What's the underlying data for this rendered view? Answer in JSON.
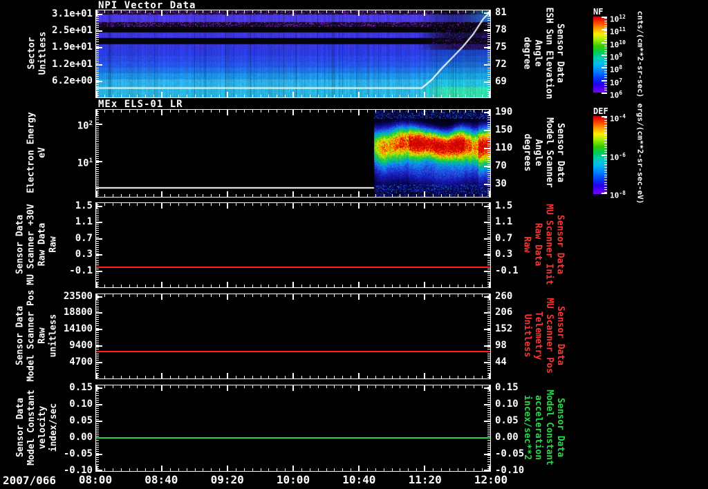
{
  "screen": {
    "background": "#000000",
    "axis_color": "#ffffff",
    "red_series_color": "#ff2222",
    "green_series_color": "#22dd44"
  },
  "x_axis": {
    "date_label": "2007/066",
    "tick_labels": [
      "08:00",
      "08:40",
      "09:20",
      "10:00",
      "10:40",
      "11:20",
      "12:00"
    ]
  },
  "panels": [
    {
      "title": "NPI Vector Data",
      "left_axis": {
        "label_lines": [
          "Sector",
          "Unitless"
        ],
        "tick_labels": [
          "3.1e+01",
          "2.5e+01",
          "1.9e+01",
          "1.2e+01",
          "6.2e+00"
        ]
      },
      "right_axis": {
        "label_lines": [
          "Sensor Data",
          "ESH Sun Elevation",
          "Angle",
          "degree"
        ],
        "tick_labels": [
          "81",
          "78",
          "75",
          "72",
          "69"
        ],
        "color": "#ffffff"
      },
      "colorbar": {
        "name": "NF",
        "units": "cnts/(cm**2-sr-sec)",
        "tick_exponents": [
          "12",
          "11",
          "10",
          "9",
          "8",
          "7",
          "6"
        ]
      }
    },
    {
      "title": "MEx ELS-01 LR",
      "left_axis": {
        "label_lines": [
          "Electron Energy",
          "eV"
        ],
        "tick_exponents": [
          "2",
          "1"
        ]
      },
      "right_axis": {
        "label_lines": [
          "Sensor Data",
          "Model Scanner",
          "Angle",
          "degrees"
        ],
        "tick_labels": [
          "190",
          "150",
          "110",
          "70",
          "30"
        ],
        "color": "#ffffff"
      },
      "colorbar": {
        "name": "DEF",
        "units": "ergs/(cm**2-sr-sec-eV)",
        "tick_exponents": [
          "-4",
          "-6",
          "-8"
        ]
      }
    },
    {
      "title": "",
      "left_axis": {
        "label_lines": [
          "Sensor Data",
          "MU Scanner +30V",
          "Raw Data",
          "Raw"
        ],
        "tick_labels": [
          "1.5",
          "1.1",
          "0.7",
          "0.3",
          "-0.1"
        ]
      },
      "right_axis": {
        "label_lines": [
          "Sensor Data",
          "MU Scanner Init",
          "Raw Data",
          "Raw"
        ],
        "tick_labels": [
          "1.5",
          "1.1",
          "0.7",
          "0.3",
          "-0.1"
        ],
        "color": "#ff3333"
      }
    },
    {
      "title": "",
      "left_axis": {
        "label_lines": [
          "Sensor Data",
          "Model Scanner Pos",
          "Raw",
          "unitless"
        ],
        "tick_labels": [
          "23500",
          "18800",
          "14100",
          "9400",
          "4700"
        ]
      },
      "right_axis": {
        "label_lines": [
          "Sensor Data",
          "MU Scanner Pos",
          "Telemetry",
          "Unitless"
        ],
        "tick_labels": [
          "260",
          "206",
          "152",
          "98",
          "44"
        ],
        "color": "#ff3333"
      }
    },
    {
      "title": "",
      "left_axis": {
        "label_lines": [
          "Sensor Data",
          "Model Constant",
          "velocity",
          "index/sec"
        ],
        "tick_labels": [
          "0.15",
          "0.10",
          "0.05",
          "0.00",
          "-0.05",
          "-0.10"
        ]
      },
      "right_axis": {
        "label_lines": [
          "Sensor Data",
          "Model Constant",
          "acceleration",
          "incex/sec**2"
        ],
        "tick_labels": [
          "0.15",
          "0.10",
          "0.05",
          "0.00",
          "-0.05",
          "-0.10"
        ],
        "color": "#22dd44"
      }
    }
  ],
  "chart_data": [
    {
      "panel": "NPI Vector Data",
      "type": "heatmap",
      "x_start": "2007/066 08:00",
      "x_end": "12:00",
      "ylabel": "Sector (Unitless)",
      "y_ticks": [
        31,
        25,
        19,
        12,
        6.2
      ],
      "z_label": "NF cnts/(cm**2-sr-sec)",
      "z_range": [
        1000000.0,
        1000000000000.0
      ],
      "description": "Horizontally banded ion spectrogram: bright cyan bands at low sectors, blue-violet bands at mid/high sectors, black gaps and noisy purple speckle rows; after ~11:20 upper bands fade to black with purple noise while lower bands brighten toward cyan-green",
      "overlay_line": {
        "name": "ESH Sun Elevation Angle (degree)",
        "x_frac": [
          0,
          0.828,
          0.853,
          0.879,
          0.905,
          0.932,
          0.958,
          0.984,
          1.0
        ],
        "deg": [
          68.0,
          68.0,
          69.4,
          71.4,
          73.2,
          75.1,
          77.2,
          79.9,
          81.0
        ]
      }
    },
    {
      "panel": "MEx ELS-01 LR",
      "type": "heatmap",
      "ylabel": "Electron Energy (eV)",
      "y_scale": "log",
      "y_ticks": [
        10,
        100
      ],
      "z_label": "DEF ergs/(cm**2-sr-sec-eV)",
      "z_range": [
        1e-08,
        0.0001
      ],
      "data_start_frac": 0.706,
      "description": "Black (no data) from 08:00 to ~10:50; electron burst from ~10:50 to 12:00 with red core near 10-40 eV, yellow-green halo, noisy blue edges; thin white line at lowest energy spans the full interval"
    },
    {
      "panel": "Sensor Data MU Scanner +30V Raw Data Raw",
      "type": "line",
      "color": "#ff2222",
      "ylim_left": [
        -0.1,
        1.5
      ],
      "ylim_right": [
        -0.1,
        1.5
      ],
      "value": 0.0
    },
    {
      "panel": "Sensor Data Model Scanner Pos Raw unitless",
      "type": "line",
      "color": "#ff2222",
      "left_ticks": [
        23500,
        18800,
        14100,
        9400,
        4700
      ],
      "right_ticks": [
        260,
        206,
        152,
        98,
        44
      ],
      "value_left": 8000,
      "value_right": 92
    },
    {
      "panel": "Sensor Data Model Constant velocity index/sec",
      "type": "line",
      "color": "#22dd44",
      "ylim": [
        -0.1,
        0.15
      ],
      "value": 0.0
    }
  ]
}
